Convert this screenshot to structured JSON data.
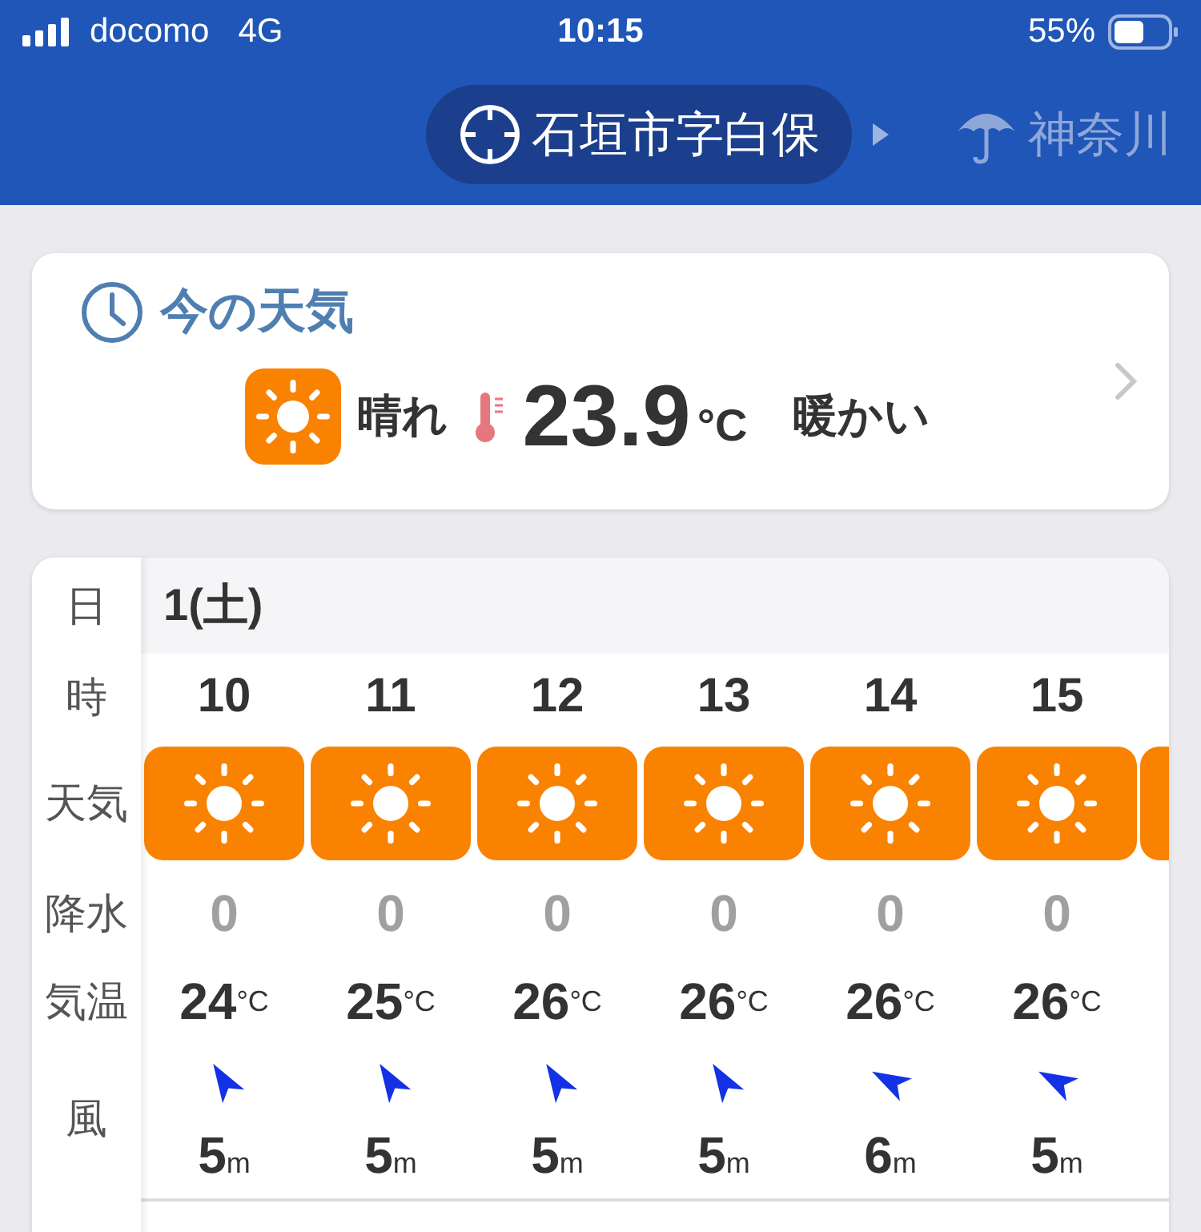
{
  "status_bar": {
    "carrier": "docomo",
    "network": "4G",
    "time": "10:15",
    "battery": "55%"
  },
  "locations": [
    {
      "name": "石垣市字白保",
      "kind": "current",
      "selected": true
    },
    {
      "name": "神奈川",
      "kind": "rain",
      "selected": false
    }
  ],
  "current": {
    "title": "今の天気",
    "kind": "sunny",
    "condition": "晴れ",
    "temperature": "23.9",
    "unit": "°C",
    "feeling": "暖かい"
  },
  "forecast": {
    "labels": {
      "date": "日",
      "hour": "時",
      "weather": "天気",
      "precip": "降水",
      "temp": "気温",
      "wind": "風"
    },
    "date": "1(土)",
    "hours": [
      {
        "hour": "10",
        "kind": "sunny",
        "precip": "0",
        "temp": "24",
        "temp_unit": "°C",
        "wind": {
          "kind": "se",
          "value": "5",
          "unit": "m"
        }
      },
      {
        "hour": "11",
        "kind": "sunny",
        "precip": "0",
        "temp": "25",
        "temp_unit": "°C",
        "wind": {
          "kind": "se",
          "value": "5",
          "unit": "m"
        }
      },
      {
        "hour": "12",
        "kind": "sunny",
        "precip": "0",
        "temp": "26",
        "temp_unit": "°C",
        "wind": {
          "kind": "se",
          "value": "5",
          "unit": "m"
        }
      },
      {
        "hour": "13",
        "kind": "sunny",
        "precip": "0",
        "temp": "26",
        "temp_unit": "°C",
        "wind": {
          "kind": "se",
          "value": "5",
          "unit": "m"
        }
      },
      {
        "hour": "14",
        "kind": "sunny",
        "precip": "0",
        "temp": "26",
        "temp_unit": "°C",
        "wind": {
          "kind": "ese",
          "value": "6",
          "unit": "m"
        }
      },
      {
        "hour": "15",
        "kind": "sunny",
        "precip": "0",
        "temp": "26",
        "temp_unit": "°C",
        "wind": {
          "kind": "ese",
          "value": "5",
          "unit": "m"
        }
      }
    ]
  }
}
